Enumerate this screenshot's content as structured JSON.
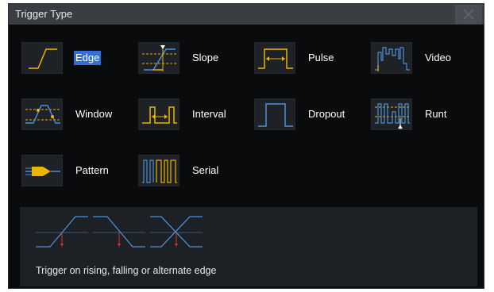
{
  "dialog": {
    "title": "Trigger Type",
    "close_icon": "close-icon"
  },
  "trigger_types": [
    {
      "label": "Edge",
      "icon": "edge-trigger-icon",
      "selected": true
    },
    {
      "label": "Slope",
      "icon": "slope-trigger-icon",
      "selected": false
    },
    {
      "label": "Pulse",
      "icon": "pulse-trigger-icon",
      "selected": false
    },
    {
      "label": "Video",
      "icon": "video-trigger-icon",
      "selected": false
    },
    {
      "label": "Window",
      "icon": "window-trigger-icon",
      "selected": false
    },
    {
      "label": "Interval",
      "icon": "interval-trigger-icon",
      "selected": false
    },
    {
      "label": "Dropout",
      "icon": "dropout-trigger-icon",
      "selected": false
    },
    {
      "label": "Runt",
      "icon": "runt-trigger-icon",
      "selected": false
    },
    {
      "label": "Pattern",
      "icon": "pattern-trigger-icon",
      "selected": false
    },
    {
      "label": "Serial",
      "icon": "serial-trigger-icon",
      "selected": false
    }
  ],
  "description": {
    "text": "Trigger on rising, falling or alternate edge",
    "diagram_icons": [
      "rising-edge-icon",
      "falling-edge-icon",
      "alternate-edge-icon"
    ]
  },
  "colors": {
    "waveform_yellow": "#e8b400",
    "trace_blue": "#4d8fd6",
    "marker_red": "#e03030",
    "selection_blue": "#2f6fd6"
  }
}
